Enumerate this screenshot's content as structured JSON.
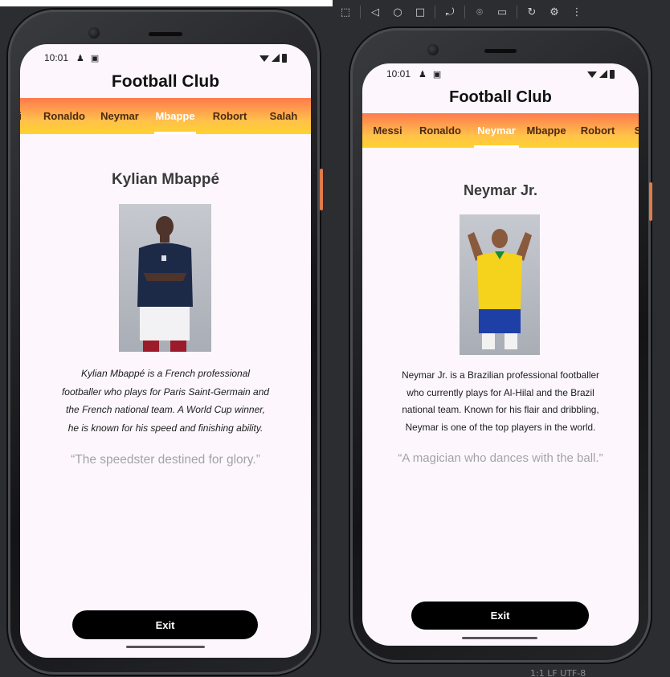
{
  "emulator_toolbar": {
    "icons": [
      "device-frame-icon",
      "back-icon",
      "home-icon",
      "overview-icon",
      "rotate-device-icon",
      "screenshot-icon",
      "record-icon",
      "undo-rotate-icon",
      "settings-icon",
      "more-icon"
    ],
    "glyphs": [
      "⬚",
      "◁",
      "○",
      "□",
      "⤾",
      "⌾",
      "▭",
      "↻",
      "⚙",
      "⋮"
    ]
  },
  "bottom_status": "1:1   LF   UTF-8",
  "left_phone": {
    "status": {
      "time": "10:01"
    },
    "app_title": "Football Club",
    "tabs": [
      {
        "label": "i",
        "active": false
      },
      {
        "label": "Ronaldo",
        "active": false
      },
      {
        "label": "Neymar",
        "active": false
      },
      {
        "label": "Mbappe",
        "active": true
      },
      {
        "label": "Robort",
        "active": false
      },
      {
        "label": "Salah",
        "active": false
      }
    ],
    "player_name": "Kylian Mbappé",
    "bio_lines": [
      "Kylian Mbappé is a French professional",
      "footballer who plays for Paris Saint-Germain and",
      "the French national team. A World Cup winner,",
      "he is known for his speed and finishing ability."
    ],
    "quote": "“The speedster destined for glory.”",
    "exit_label": "Exit"
  },
  "right_phone": {
    "status": {
      "time": "10:01"
    },
    "app_title": "Football Club",
    "tabs": [
      {
        "label": "Messi",
        "active": false
      },
      {
        "label": "Ronaldo",
        "active": false
      },
      {
        "label": "Neymar",
        "active": true
      },
      {
        "label": "Mbappe",
        "active": false
      },
      {
        "label": "Robort",
        "active": false
      },
      {
        "label": "S",
        "active": false
      }
    ],
    "player_name": "Neymar Jr.",
    "bio_lines": [
      "Neymar Jr. is a Brazilian professional footballer",
      "who currently plays for Al-Hilal and the Brazil",
      "national team. Known for his flair and dribbling,",
      "Neymar is one of the top players in the world."
    ],
    "quote": "“A magician who dances with the ball.”",
    "exit_label": "Exit"
  }
}
